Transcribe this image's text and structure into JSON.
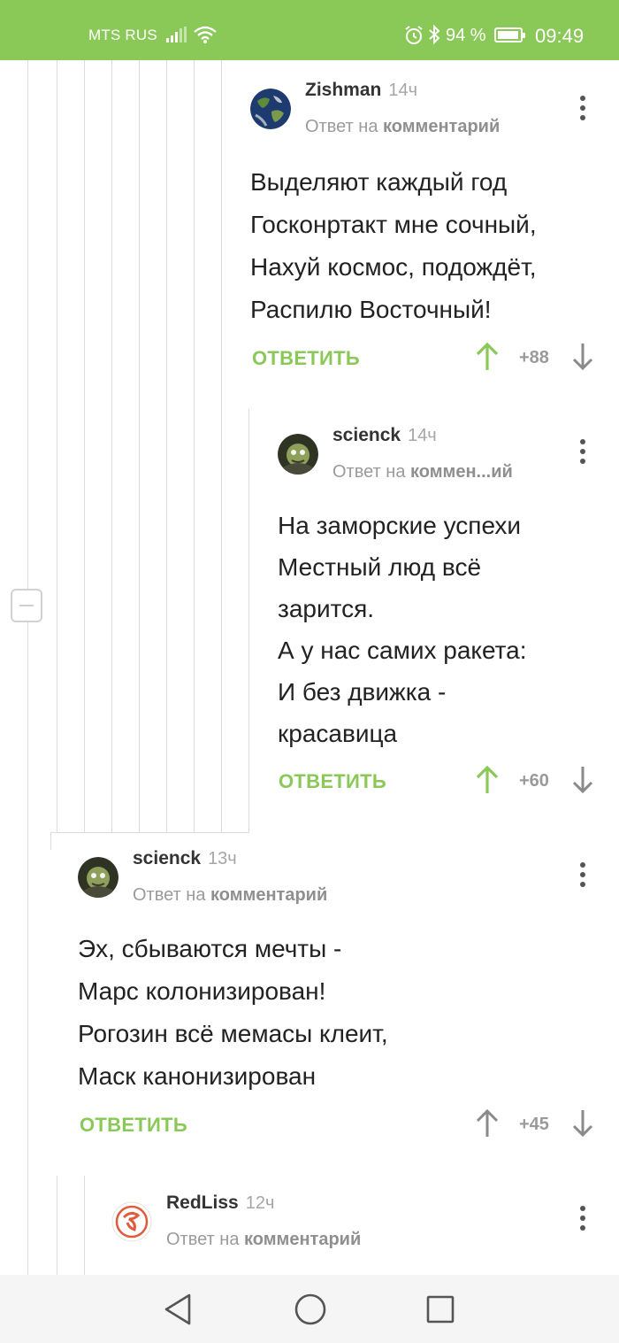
{
  "status_bar": {
    "carrier": "MTS RUS",
    "battery_percent": "94 %",
    "time": "09:49",
    "icons": [
      "signal-icon",
      "wifi-icon",
      "alarm-icon",
      "bluetooth-icon",
      "battery-icon"
    ]
  },
  "comments": [
    {
      "username": "Zishman",
      "time": "14ч",
      "reply_prefix": "Ответ на",
      "reply_target": "комментарий",
      "lines": [
        "Выделяют каждый год",
        "Госконртакт мне сочный,",
        "Нахуй космос, подождёт,",
        "Распилю Восточный!"
      ],
      "reply_label": "ОТВЕТИТЬ",
      "score": "+88",
      "upvoted": true
    },
    {
      "username": "scienck",
      "time": "14ч",
      "reply_prefix": "Ответ на",
      "reply_target": "коммен...ий",
      "lines": [
        "На заморские успехи",
        "Местный люд всё",
        "зарится.",
        "А у нас самих ракета:",
        "И без движка -",
        "красавица"
      ],
      "reply_label": "ОТВЕТИТЬ",
      "score": "+60",
      "upvoted": true
    },
    {
      "username": "scienck",
      "time": "13ч",
      "reply_prefix": "Ответ на",
      "reply_target": "комментарий",
      "lines": [
        "Эх, сбываются мечты -",
        "Марс колонизирован!",
        "Рогозин всё мемасы клеит,",
        "Маск канонизирован"
      ],
      "reply_label": "ОТВЕТИТЬ",
      "score": "+45",
      "upvoted": false
    },
    {
      "username": "RedLiss",
      "time": "12ч",
      "reply_prefix": "Ответ на",
      "reply_target": "комментарий"
    }
  ],
  "colors": {
    "status_bar": "#8ac858",
    "accent": "#8ac858",
    "upvote_active": "#8ac858",
    "vote_inactive": "#8a8a8a",
    "thread_line": "#dcdcdc"
  },
  "nav_bar": {
    "icons": [
      "back-icon",
      "home-icon",
      "recent-apps-icon"
    ]
  }
}
